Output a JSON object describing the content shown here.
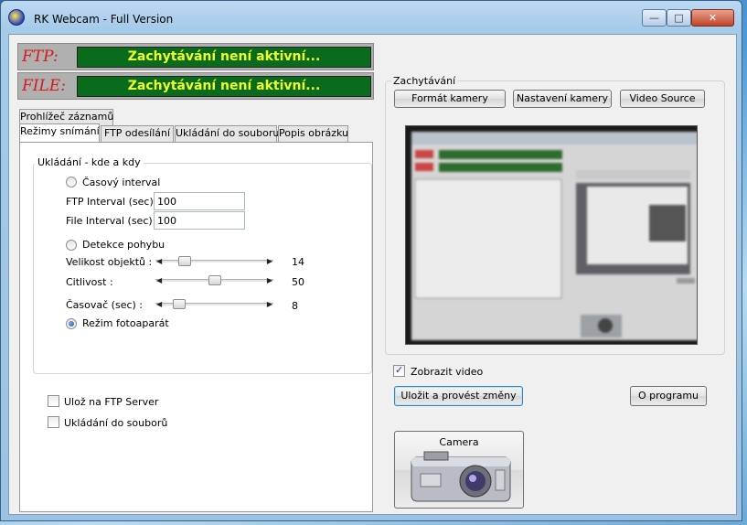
{
  "window": {
    "title": "RK Webcam - Full Version"
  },
  "status": {
    "ftp_label": "FTP:",
    "ftp_text": "Zachytávání není aktivní...",
    "file_label": "FILE:",
    "file_text": "Zachytávání není aktivní..."
  },
  "tabs": {
    "row_top": [
      "Prohlížeč záznamů"
    ],
    "row_bottom": [
      "Režimy snímání",
      "FTP odesílání",
      "Ukládání do souboru",
      "Popis obrázku"
    ],
    "active": "Režimy snímání"
  },
  "capture_mode": {
    "group_title": "Ukládání  - kde a kdy",
    "timer_radio": "Časový interval",
    "ftp_interval_label": "FTP Interval (sec) :",
    "ftp_interval_value": "100",
    "file_interval_label": "File Interval (sec) :",
    "file_interval_value": "100",
    "motion_radio": "Detekce pohybu",
    "object_size_label": "Velikost objektů :",
    "object_size_value": "14",
    "sensitivity_label": "Citlivost :",
    "sensitivity_value": "50",
    "timer_label": "Časovač (sec) :",
    "timer_value": "8",
    "photo_radio": "Režim fotoaparát",
    "selected_mode": "Režim fotoaparát"
  },
  "sliders": {
    "object_size_fraction": 0.14,
    "sensitivity_fraction": 0.5,
    "timer_fraction": 0.08
  },
  "options": {
    "ftp_server": "Ulož na FTP Server",
    "save_to_file": "Ukládání do souborů"
  },
  "capture": {
    "group_title": "Zachytávání",
    "camera_format": "Formát kamery",
    "camera_settings": "Nastavení kamery",
    "video_source": "Video Source",
    "show_video": "Zobrazit video",
    "show_video_checked": true
  },
  "actions": {
    "save_apply": "Uložit a provést změny",
    "about": "O programu",
    "camera": "Camera"
  },
  "colors": {
    "status_bg": "#0a6b1c",
    "status_text": "#f0ff2a",
    "label_red": "#d41a1a"
  }
}
